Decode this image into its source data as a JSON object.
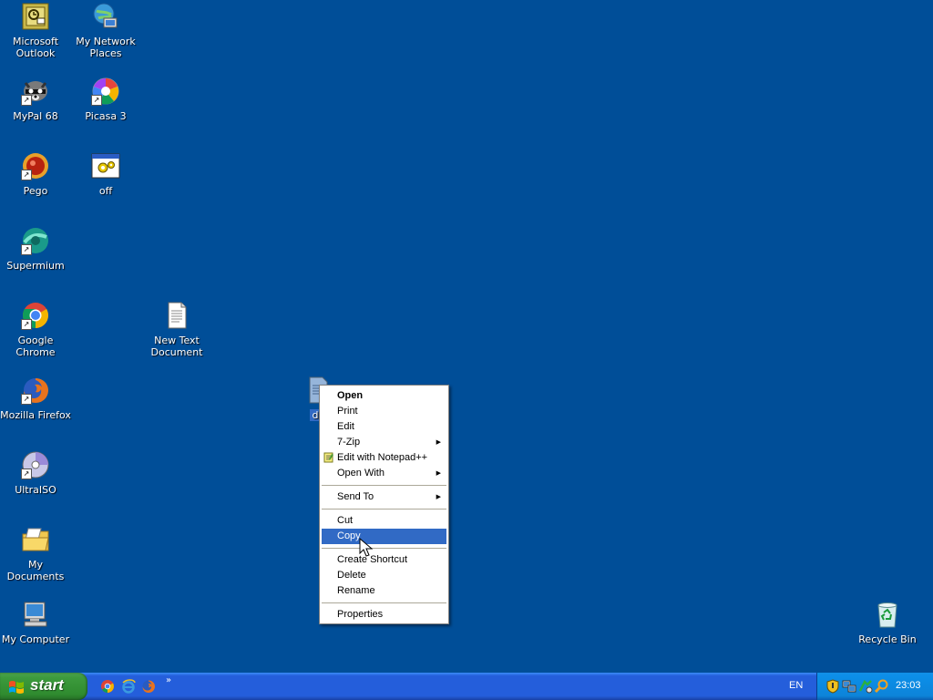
{
  "desktop": {
    "background_color": "#004e98",
    "icons": {
      "outlook": "Microsoft Outlook",
      "network": "My Network Places",
      "mypal": "MyPal 68",
      "picasa": "Picasa 3",
      "pego": "Pego",
      "off": "off",
      "supermium": "Supermium",
      "chrome": "Google Chrome",
      "newtext": "New Text Document",
      "firefox": "Mozilla Firefox",
      "selected_file": "dc",
      "ultraiso": "UltraISO",
      "mydocs": "My Documents",
      "mycomputer": "My Computer",
      "recycle": "Recycle Bin"
    }
  },
  "context_menu": {
    "items": {
      "open": "Open",
      "print": "Print",
      "edit": "Edit",
      "zip": "7-Zip",
      "notepadpp": "Edit with Notepad++",
      "openwith": "Open With",
      "sendto": "Send To",
      "cut": "Cut",
      "copy": "Copy",
      "shortcut": "Create Shortcut",
      "delete": "Delete",
      "rename": "Rename",
      "properties": "Properties"
    },
    "highlighted": "Copy",
    "highlight_color": "#316ac5"
  },
  "taskbar": {
    "start_label": "start",
    "quick_launch": [
      "chrome-icon",
      "internet-explorer-icon",
      "firefox-icon"
    ],
    "more_chevron": "»",
    "language": "EN",
    "clock": "23:03"
  }
}
